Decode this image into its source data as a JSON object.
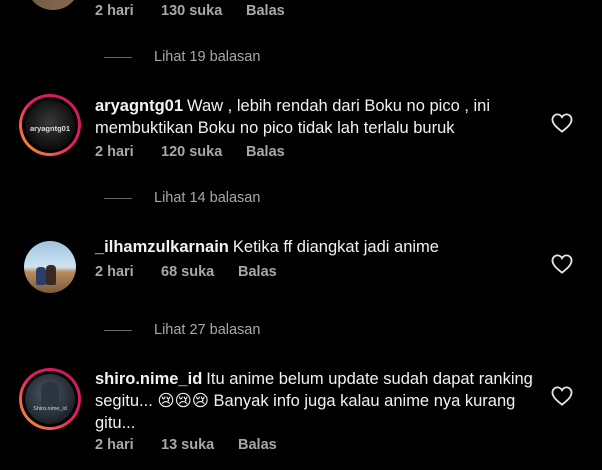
{
  "comments_top": {
    "time": "2 hari",
    "likes": "130 suka",
    "reply": "Balas"
  },
  "view_replies": [
    {
      "label": "Lihat 19 balasan"
    },
    {
      "label": "Lihat 14 balasan"
    },
    {
      "label": "Lihat 27 balasan"
    }
  ],
  "comments": [
    {
      "username": "aryagntg01",
      "text": "Waw , lebih rendah dari Boku no pico , ini membuktikan Boku no pico tidak lah terlalu buruk",
      "time": "2 hari",
      "likes": "120 suka",
      "reply": "Balas",
      "avatar_caption": "aryagntg01"
    },
    {
      "username": "_ilhamzulkarnain",
      "text": "Ketika ff diangkat jadi anime",
      "time": "2 hari",
      "likes": "68 suka",
      "reply": "Balas"
    },
    {
      "username": "shiro.nime_id",
      "text": "Itu anime belum update sudah dapat ranking segitu... 😢😢😢 Banyak info juga kalau anime nya kurang gitu...",
      "time": "2 hari",
      "likes": "13 suka",
      "reply": "Balas",
      "avatar_caption": "Shiro.nime_id"
    }
  ],
  "icons": {
    "like": "heart-outline-icon"
  },
  "colors": {
    "background": "#000000",
    "meta_text": "#a8a8a8",
    "ring_start": "#f9a825",
    "ring_end": "#c2185b"
  }
}
